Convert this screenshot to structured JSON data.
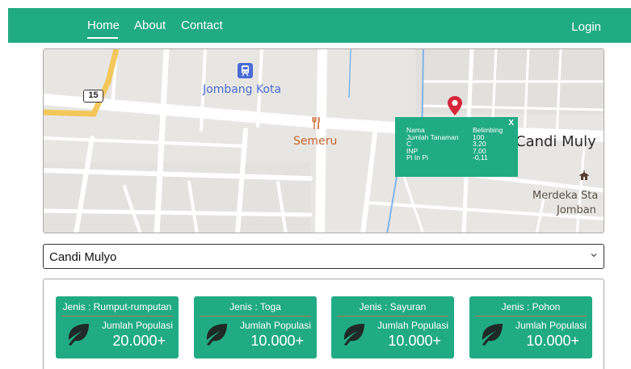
{
  "navbar": {
    "links": [
      {
        "label": "Home",
        "active": true
      },
      {
        "label": "About"
      },
      {
        "label": "Contact"
      }
    ],
    "login_label": "Login",
    "color": "#21ab84"
  },
  "map": {
    "labels": {
      "jombang_kota": "Jombang Kota",
      "semeru": "Semeru",
      "candi_mulyo": "Candi Muly",
      "merdeka": "Merdeka Sta",
      "jomban": "Jomban"
    },
    "road_badge": "15",
    "icons": [
      "train-station-icon",
      "restaurant-icon",
      "location-marker-icon",
      "building-icon"
    ],
    "popup": {
      "close": "X",
      "rows": [
        {
          "key": "Nama",
          "value": "Belimbing"
        },
        {
          "key": "Jumlah Tanaman",
          "value": "100"
        },
        {
          "key": "C",
          "value": "3,20"
        },
        {
          "key": "INP",
          "value": "7,00"
        },
        {
          "key": "Pi In Pi",
          "value": "-0,11"
        }
      ]
    }
  },
  "location_select": {
    "value": "Candi Mulyo"
  },
  "cards": [
    {
      "title": "Jenis : Rumput-rumputan",
      "label": "Jumlah Populasi",
      "value": "20.000+",
      "icon": "leaf-icon"
    },
    {
      "title": "Jenis : Toga",
      "label": "Jumlah Populasi",
      "value": "10.000+",
      "icon": "leaf-icon"
    },
    {
      "title": "Jenis : Sayuran",
      "label": "Jumlah Populasi",
      "value": "10.000+",
      "icon": "leaf-icon"
    },
    {
      "title": "Jenis : Pohon",
      "label": "Jumlah Populasi",
      "value": "10.000+",
      "icon": "leaf-icon"
    }
  ]
}
